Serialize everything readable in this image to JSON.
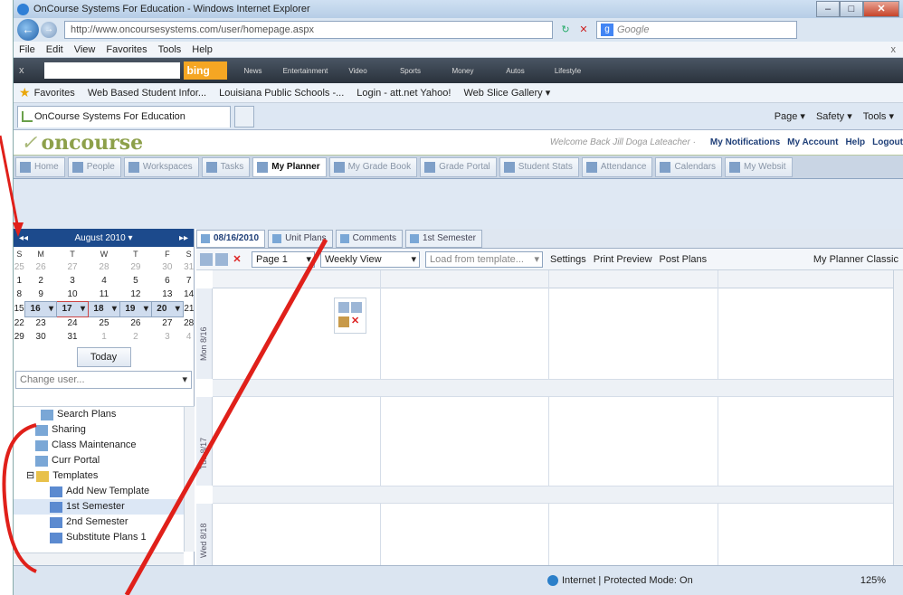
{
  "window": {
    "title": "OnCourse Systems For Education - Windows Internet Explorer"
  },
  "browser": {
    "url": "http://www.oncoursesystems.com/user/homepage.aspx",
    "search_placeholder": "Google",
    "menu": [
      "File",
      "Edit",
      "View",
      "Favorites",
      "Tools",
      "Help"
    ],
    "bing_label": "bing",
    "bing_items": [
      "News",
      "Entertainment",
      "Video",
      "Sports",
      "Money",
      "Autos",
      "Lifestyle"
    ],
    "favorites_label": "Favorites",
    "favorites": [
      "Web Based Student Infor...",
      "Louisiana Public Schools -...",
      "Login - att.net Yahoo!",
      "Web Slice Gallery ▾"
    ],
    "tab_title": "OnCourse Systems For Education",
    "tools": [
      "Page ▾",
      "Safety ▾",
      "Tools ▾"
    ]
  },
  "app": {
    "logo": "oncourse",
    "welcome": "Welcome Back Jill Doga Lateacher ·",
    "header_links": [
      "My Notifications",
      "My Account",
      "Help",
      "Logout"
    ],
    "tabs": [
      "Home",
      "People",
      "Workspaces",
      "Tasks",
      "My Planner",
      "My Grade Book",
      "Grade Portal",
      "Student Stats",
      "Attendance",
      "Calendars",
      "My Websit"
    ],
    "active_tab": "My Planner"
  },
  "calendar": {
    "month": "August 2010 ▾",
    "dow": [
      "S",
      "M",
      "T",
      "W",
      "T",
      "F",
      "S"
    ],
    "weeks": [
      [
        "25",
        "26",
        "27",
        "28",
        "29",
        "30",
        "31"
      ],
      [
        "1",
        "2",
        "3",
        "4",
        "5",
        "6",
        "7"
      ],
      [
        "8",
        "9",
        "10",
        "11",
        "12",
        "13",
        "14"
      ],
      [
        "15",
        "16",
        "17",
        "18",
        "19",
        "20",
        "21"
      ],
      [
        "22",
        "23",
        "24",
        "25",
        "26",
        "27",
        "28"
      ],
      [
        "29",
        "30",
        "31",
        "1",
        "2",
        "3",
        "4"
      ]
    ],
    "today_label": "Today"
  },
  "change_user": {
    "placeholder": "Change user..."
  },
  "tree": {
    "items": [
      "Search Plans",
      "Sharing",
      "Class Maintenance",
      "Curr Portal",
      "Templates",
      "Add New Template",
      "1st Semester",
      "2nd Semester",
      "Substitute Plans 1"
    ]
  },
  "planner": {
    "doc_tabs": [
      "08/16/2010",
      "Unit Plans",
      "Comments",
      "1st Semester"
    ],
    "page_select": "Page 1",
    "view_select": "Weekly View",
    "template_select": "Load from template...",
    "settings": "Settings",
    "print_preview": "Print Preview",
    "post_plans": "Post Plans",
    "classic": "My Planner Classic",
    "days": [
      "Mon 8/16",
      "Tue 8/17",
      "Wed 8/18"
    ]
  },
  "status": {
    "zone": "Internet | Protected Mode: On",
    "zoom": "125%"
  },
  "colors": {
    "brand": "#8da04a",
    "calendar_header": "#1c4a8c",
    "annotation": "#e0201a"
  }
}
